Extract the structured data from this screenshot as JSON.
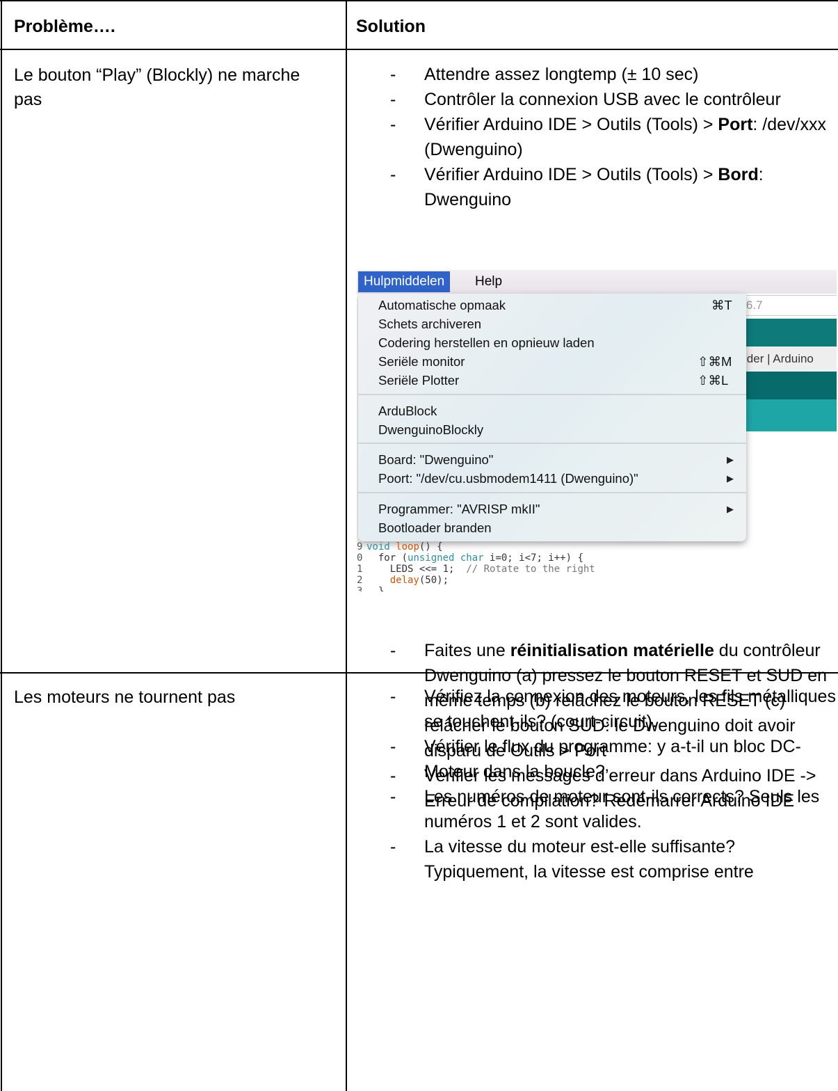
{
  "table": {
    "header": {
      "problem": "Problème….",
      "solution": "Solution"
    },
    "rows": [
      {
        "problem": "Le bouton “Play” (Blockly) ne marche pas",
        "solutions_top": [
          "Attendre assez longtemp (± 10 sec)",
          "Contrôler la connexion USB avec le contrôleur",
          {
            "before": "Vérifier Arduino IDE > Outils (Tools) > ",
            "bold": "Port",
            "after": ": /dev/xxx (Dwenguino)"
          },
          {
            "before": "Vérifier Arduino IDE > Outils (Tools) > ",
            "bold": "Bord",
            "after": ": Dwenguino"
          }
        ],
        "solutions_bottom": [
          {
            "before": "Faites une ",
            "bold": "réinitialisation matérielle",
            "after": " du contrôleur Dwenguino (a) pressez le bouton RESET et SUD en même temps (b) relâchez le bouton RESET (c) relâcher le bouton SUD: le Dwenguino doit avoir disparu de Outils > Port"
          },
          "Vérifier les messages d’erreur dans Arduino IDE -> Erreur de compilation? Redémarrer Arduino IDE"
        ]
      },
      {
        "problem": "Les moteurs ne tournent pas",
        "solutions": [
          "Vérifiez la connexion des moteurs, les fils métalliques se touchent-ils? (court-circuit).",
          "Vérifier le flux du programme: y a-t-il un bloc DC-Moteur dans la boucle?",
          "Les numéros de moteur sont-ils corrects? Seuls les numéros 1 et 2 sont valides.",
          "La vitesse du moteur est-elle suffisante? Typiquement, la vitesse est comprise entre"
        ]
      }
    ]
  },
  "screenshot": {
    "menubar": {
      "active": "Hulpmiddelen",
      "other": "Help"
    },
    "background": {
      "version": "1.6.7",
      "tab": "Rider | Arduino"
    },
    "menu_groups": [
      [
        {
          "label": "Automatische opmaak",
          "shortcut": "⌘T"
        },
        {
          "label": "Schets archiveren"
        },
        {
          "label": "Codering herstellen en opnieuw laden"
        },
        {
          "label": "Seriële monitor",
          "shortcut": "⇧⌘M"
        },
        {
          "label": "Seriële Plotter",
          "shortcut": "⇧⌘L"
        }
      ],
      [
        {
          "label": "ArduBlock"
        },
        {
          "label": "DwenguinoBlockly"
        }
      ],
      [
        {
          "label": "Board: \"Dwenguino\"",
          "submenu": "▶"
        },
        {
          "label": "Poort: \"/dev/cu.usbmodem1411 (Dwenguino)\"",
          "submenu": "▶"
        }
      ],
      [
        {
          "label": "Programmer: \"AVRISP mkII\"",
          "submenu": "▶"
        },
        {
          "label": "Bootloader branden"
        }
      ]
    ],
    "code": {
      "line_numbers": [
        "9",
        "0",
        "1",
        "2",
        "3"
      ],
      "lines": {
        "l1_kw": "void",
        "l1_fn": "loop",
        "l1_rest": "() {",
        "l2_a": "  for (",
        "l2_kw": "unsigned char",
        "l2_b": " i=0; i<7; i++) {",
        "l3_a": "    LEDS <<= 1;  ",
        "l3_cm": "// Rotate to the right",
        "l4_fn": "    delay",
        "l4_b": "(50);",
        "l5": "  }"
      }
    }
  },
  "colors": {
    "menu_highlight": "#2f63c9",
    "teal": "#0e7a7a",
    "keyword": "#2a8f9e",
    "function": "#d35400"
  }
}
